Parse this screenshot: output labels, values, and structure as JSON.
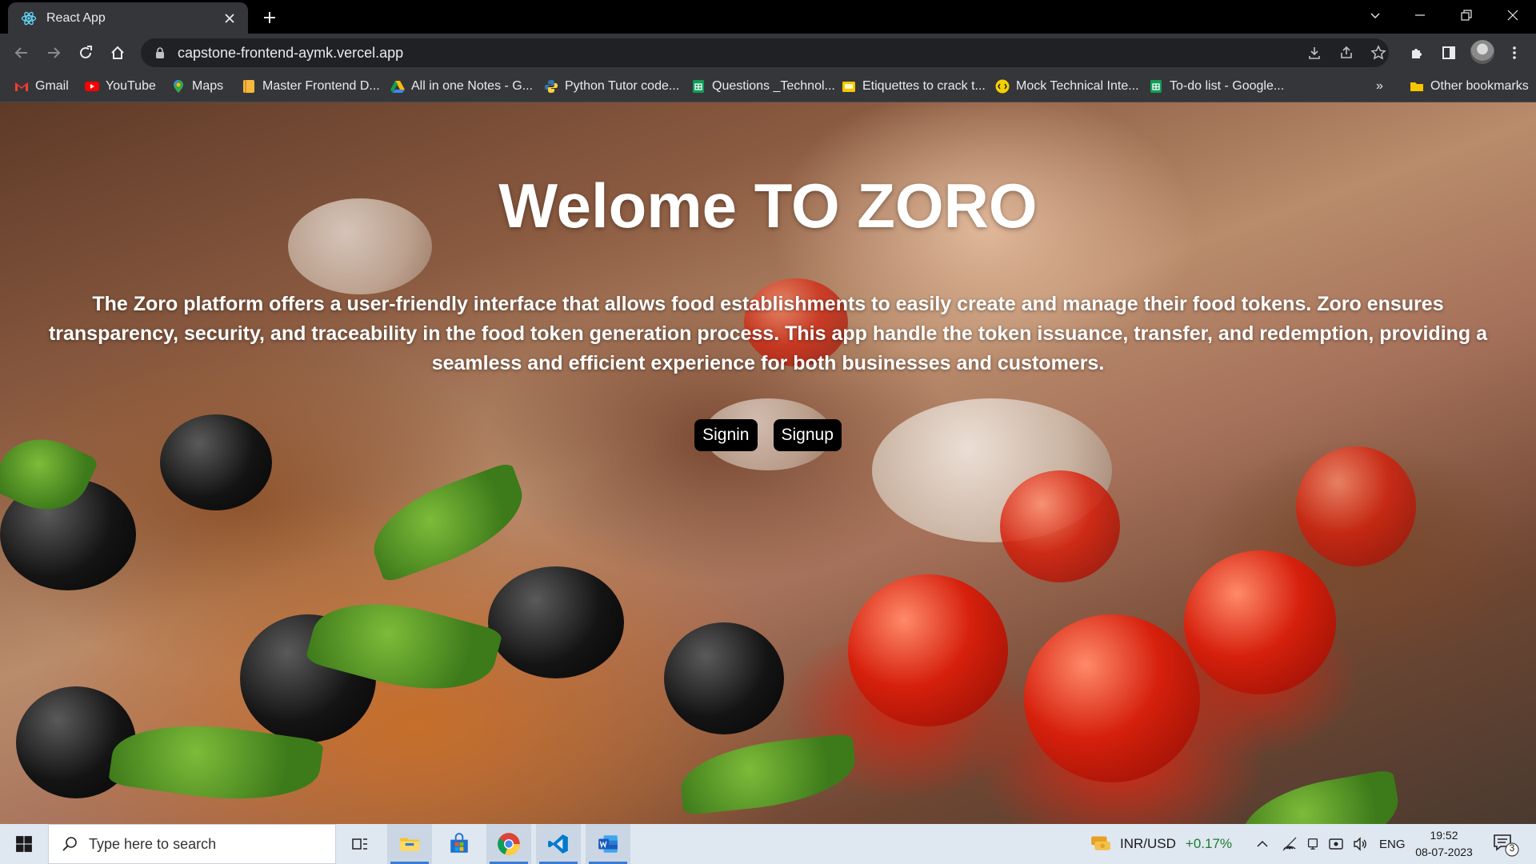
{
  "browser": {
    "tab_title": "React App",
    "url": "capstone-frontend-aymk.vercel.app",
    "bookmarks": [
      {
        "label": "Gmail",
        "icon": "gmail-icon"
      },
      {
        "label": "YouTube",
        "icon": "youtube-icon"
      },
      {
        "label": "Maps",
        "icon": "maps-icon"
      },
      {
        "label": "Master Frontend D...",
        "icon": "notebook-icon"
      },
      {
        "label": "All in one Notes - G...",
        "icon": "drive-icon"
      },
      {
        "label": "Python Tutor code...",
        "icon": "python-icon"
      },
      {
        "label": "Questions _Technol...",
        "icon": "sheets-icon"
      },
      {
        "label": "Etiquettes to crack t...",
        "icon": "folder-note-icon"
      },
      {
        "label": "Mock Technical Inte...",
        "icon": "mock-interview-icon"
      },
      {
        "label": "To-do list - Google...",
        "icon": "sheets-icon"
      }
    ],
    "more_bookmarks": "»",
    "other_bookmarks": "Other bookmarks"
  },
  "hero": {
    "title": "Welome TO ZORO",
    "description": "The Zoro platform offers a user-friendly interface that allows food establishments to easily create and manage their food tokens. Zoro ensures transparency, security, and traceability in the food token generation process. This app handle the token issuance, transfer, and redemption, providing a seamless and efficient experience for both businesses and customers.",
    "signin_label": "Signin",
    "signup_label": "Signup"
  },
  "taskbar": {
    "search_placeholder": "Type here to search",
    "currency_label": "INR/USD",
    "currency_change": "+0.17%",
    "language": "ENG",
    "time": "19:52",
    "date": "08-07-2023",
    "notification_count": "3"
  }
}
